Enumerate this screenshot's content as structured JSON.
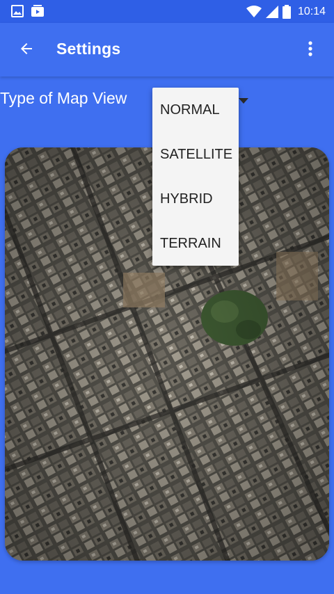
{
  "status_bar": {
    "time": "10:14",
    "left_icons": [
      "image-icon",
      "media-icon"
    ],
    "right_icons": [
      "wifi-icon",
      "signal-icon",
      "battery-icon"
    ]
  },
  "app_bar": {
    "title": "Settings",
    "back_icon": "arrow-back-icon",
    "menu_icon": "more-vert-icon"
  },
  "settings": {
    "map_view_label": "Type of Map View",
    "selected_map_type": "SATELLITE"
  },
  "dropdown": {
    "items": [
      {
        "label": "NORMAL"
      },
      {
        "label": "SATELLITE"
      },
      {
        "label": "HYBRID"
      },
      {
        "label": "TERRAIN"
      }
    ]
  },
  "colors": {
    "primary": "#3f6ff0",
    "primary_dark": "#2f5fe6",
    "dropdown_bg": "#f4f4f4"
  }
}
